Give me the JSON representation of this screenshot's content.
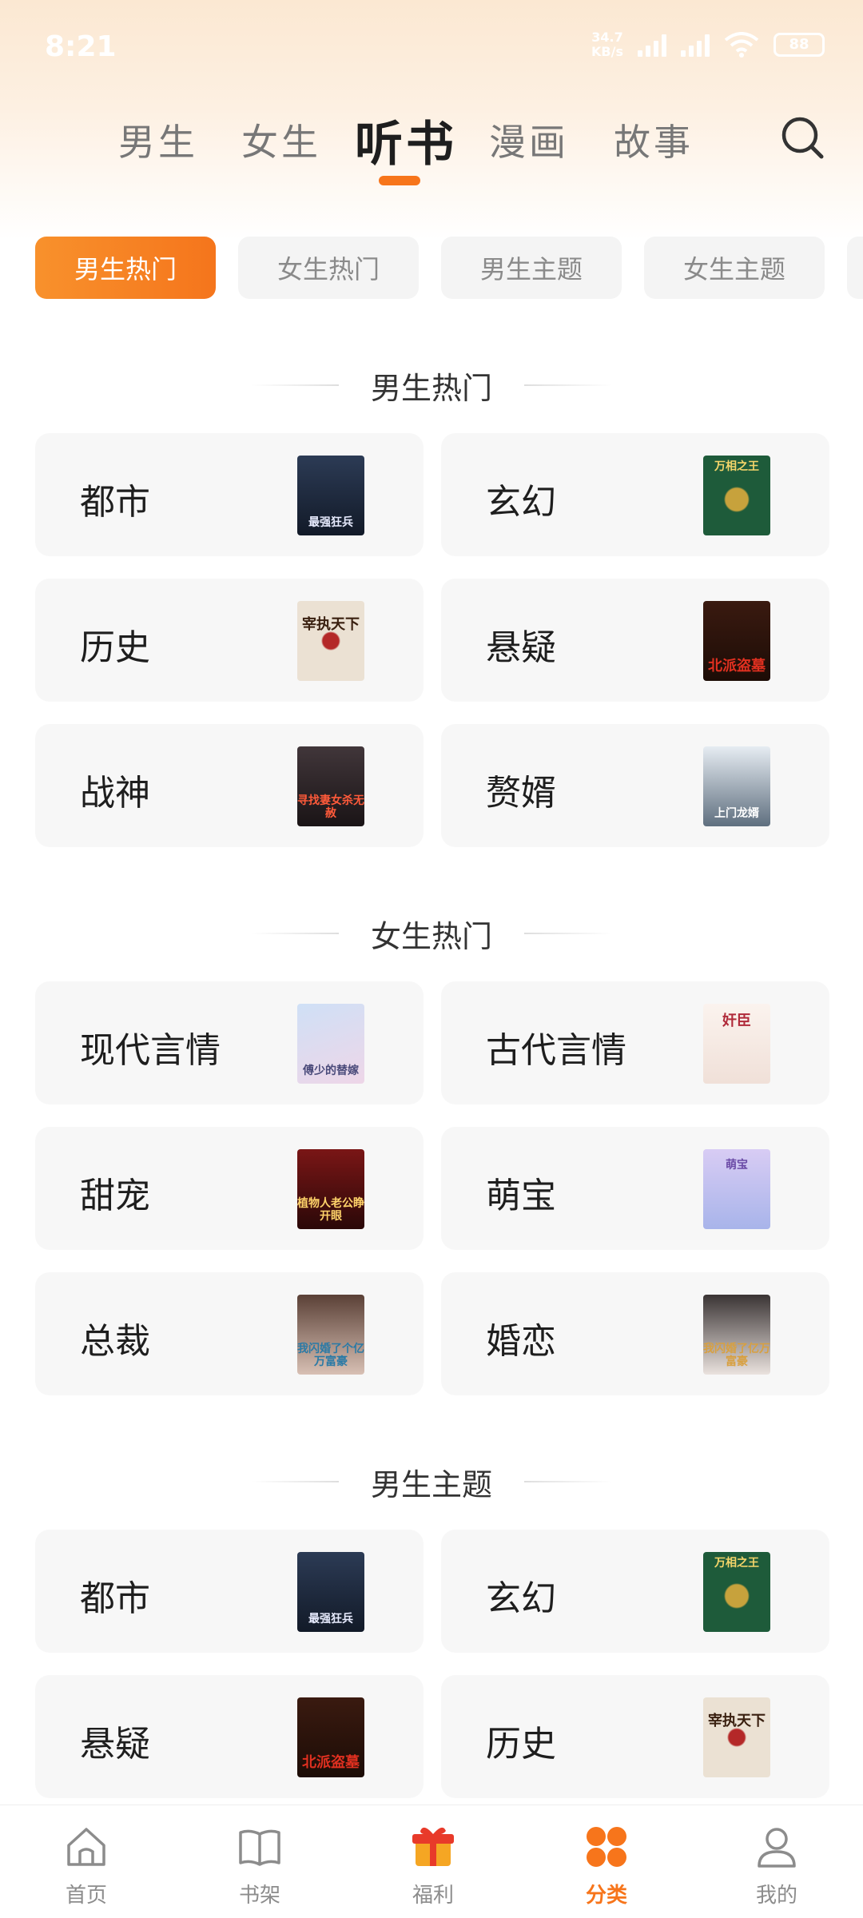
{
  "status_bar": {
    "time": "8:21",
    "net_speed_value": "34.7",
    "net_speed_unit": "KB/s",
    "battery": "88"
  },
  "top_tabs": [
    {
      "label": "男生",
      "active": false
    },
    {
      "label": "女生",
      "active": false
    },
    {
      "label": "听书",
      "active": true
    },
    {
      "label": "漫画",
      "active": false
    },
    {
      "label": "故事",
      "active": false
    }
  ],
  "search_icon": "search-icon",
  "accent_color": "#f7751b",
  "chips": [
    {
      "label": "男生热门",
      "active": true
    },
    {
      "label": "女生热门",
      "active": false
    },
    {
      "label": "男生主题",
      "active": false
    },
    {
      "label": "女生主题",
      "active": false
    }
  ],
  "sections": [
    {
      "title": "男生热门",
      "items": [
        {
          "label": "都市",
          "cover_text": "最强狂兵"
        },
        {
          "label": "玄幻",
          "cover_text": "万相之王"
        },
        {
          "label": "历史",
          "cover_text": "宰执天下"
        },
        {
          "label": "悬疑",
          "cover_text": "北派盗墓"
        },
        {
          "label": "战神",
          "cover_text": "寻找妻女杀无赦"
        },
        {
          "label": "赘婿",
          "cover_text": "上门龙婿"
        }
      ]
    },
    {
      "title": "女生热门",
      "items": [
        {
          "label": "现代言情",
          "cover_text": "傅少的替嫁"
        },
        {
          "label": "古代言情",
          "cover_text": "奸臣"
        },
        {
          "label": "甜宠",
          "cover_text": "植物人老公睁开眼"
        },
        {
          "label": "萌宝",
          "cover_text": "萌宝"
        },
        {
          "label": "总裁",
          "cover_text": "我闪婚了个亿万富豪"
        },
        {
          "label": "婚恋",
          "cover_text": "我闪婚了亿万富豪"
        }
      ]
    },
    {
      "title": "男生主题",
      "items": [
        {
          "label": "都市",
          "cover_text": "最强狂兵"
        },
        {
          "label": "玄幻",
          "cover_text": "万相之王"
        },
        {
          "label": "悬疑",
          "cover_text": "北派盗墓"
        },
        {
          "label": "历史",
          "cover_text": "宰执天下"
        }
      ]
    }
  ],
  "bottom_nav": [
    {
      "label": "首页",
      "icon": "home-icon",
      "active": false
    },
    {
      "label": "书架",
      "icon": "bookshelf-icon",
      "active": false
    },
    {
      "label": "福利",
      "icon": "gift-icon",
      "active": false
    },
    {
      "label": "分类",
      "icon": "category-icon",
      "active": true
    },
    {
      "label": "我的",
      "icon": "profile-icon",
      "active": false
    }
  ]
}
